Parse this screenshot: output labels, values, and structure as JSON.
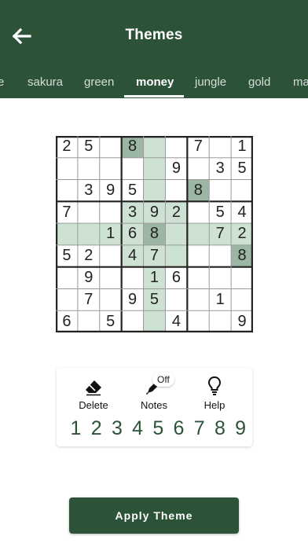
{
  "header": {
    "title": "Themes",
    "tabs": [
      {
        "label": "e",
        "active": false
      },
      {
        "label": "sakura",
        "active": false
      },
      {
        "label": "green",
        "active": false
      },
      {
        "label": "money",
        "active": true
      },
      {
        "label": "jungle",
        "active": false
      },
      {
        "label": "gold",
        "active": false
      },
      {
        "label": "ma",
        "active": false
      }
    ]
  },
  "board": {
    "rows": [
      [
        "2",
        "5",
        "",
        "8",
        "",
        "",
        "7",
        "",
        "1"
      ],
      [
        "",
        "",
        "",
        "",
        "",
        "9",
        "",
        "3",
        "5"
      ],
      [
        "",
        "3",
        "9",
        "5",
        "",
        "",
        "8",
        "",
        ""
      ],
      [
        "7",
        "",
        "",
        "3",
        "9",
        "2",
        "",
        "5",
        "4"
      ],
      [
        "",
        "",
        "1",
        "6",
        "8",
        "",
        "",
        "7",
        "2"
      ],
      [
        "5",
        "2",
        "",
        "4",
        "7",
        "",
        "",
        "",
        "8"
      ],
      [
        "",
        "9",
        "",
        "",
        "1",
        "6",
        "",
        "",
        ""
      ],
      [
        "",
        "7",
        "",
        "9",
        "5",
        "",
        "",
        "1",
        ""
      ],
      [
        "6",
        "",
        "5",
        "",
        "",
        "4",
        "",
        "",
        "9"
      ]
    ],
    "selected": {
      "row": 4,
      "col": 4
    },
    "highlight_color": "#cde2d3",
    "match_color": "#9cb6a4"
  },
  "controls": {
    "delete_label": "Delete",
    "notes_label": "Notes",
    "notes_badge": "Off",
    "help_label": "Help",
    "numbers": [
      "1",
      "2",
      "3",
      "4",
      "5",
      "6",
      "7",
      "8",
      "9"
    ]
  },
  "apply_button": {
    "label": "Apply Theme"
  },
  "colors": {
    "primary": "#2c5338",
    "background": "#ffffff"
  }
}
